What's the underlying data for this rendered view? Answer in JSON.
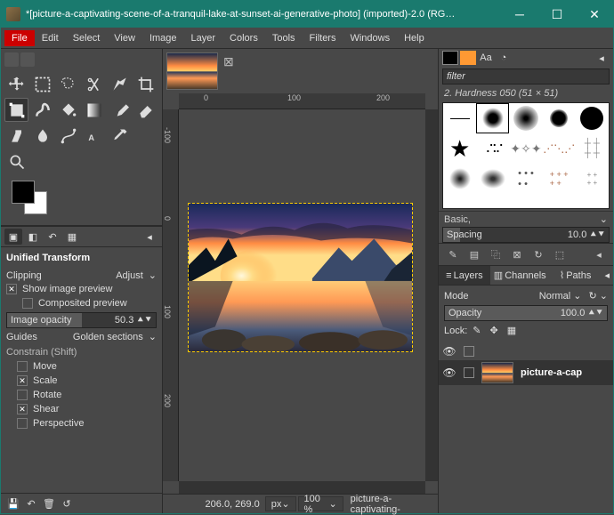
{
  "title": "*[picture-a-captivating-scene-of-a-tranquil-lake-at-sunset-ai-generative-photo] (imported)-2.0 (RG…",
  "menu": [
    "File",
    "Edit",
    "Select",
    "View",
    "Image",
    "Layer",
    "Colors",
    "Tools",
    "Filters",
    "Windows",
    "Help"
  ],
  "tool_options": {
    "title": "Unified Transform",
    "clipping_label": "Clipping",
    "clipping_value": "Adjust",
    "show_preview": "Show image preview",
    "composited": "Composited preview",
    "opacity_label": "Image opacity",
    "opacity_value": "50.3",
    "guides_label": "Guides",
    "guides_value": "Golden sections",
    "constrain_label": "Constrain (Shift)",
    "move": "Move",
    "scale": "Scale",
    "rotate": "Rotate",
    "shear": "Shear",
    "perspective": "Perspective"
  },
  "brushes": {
    "filter_placeholder": "filter",
    "current": "2. Hardness 050 (51 × 51)",
    "preset": "Basic,",
    "spacing_label": "Spacing",
    "spacing_value": "10.0"
  },
  "layers": {
    "tabs": [
      "Layers",
      "Channels",
      "Paths"
    ],
    "mode_label": "Mode",
    "mode_value": "Normal",
    "opacity_label": "Opacity",
    "opacity_value": "100.0",
    "lock_label": "Lock:",
    "layer_name": "picture-a-cap"
  },
  "status": {
    "coords": "206.0, 269.0",
    "unit": "px",
    "zoom": "100 %",
    "filename": "picture-a-captivating-"
  },
  "ruler_h": [
    "0",
    "100",
    "200"
  ],
  "ruler_v": [
    "-100",
    "0",
    "100",
    "200"
  ]
}
